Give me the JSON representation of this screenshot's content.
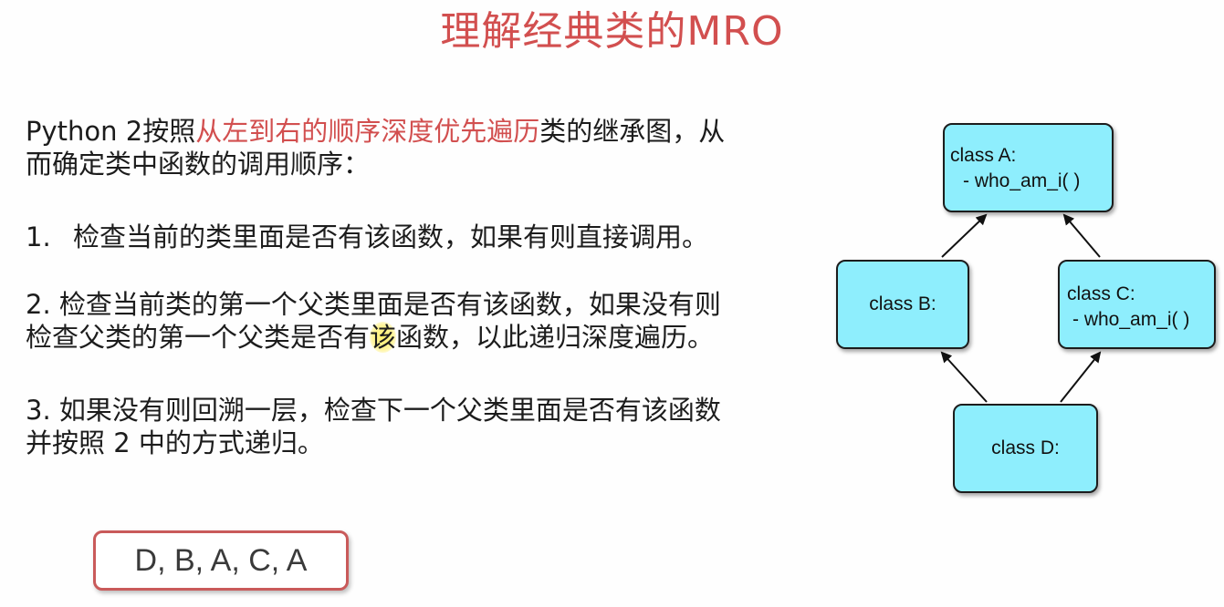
{
  "title": "理解经典类的MRO",
  "intro": {
    "before": "Python 2按照",
    "highlight": "从左到右的顺序深度优先遍历",
    "after": "类的继承图，从",
    "line2": "而确定类中函数的调用顺序："
  },
  "steps": [
    {
      "number": "1.",
      "text": "检查当前的类里面是否有该函数，如果有则直接调用。"
    },
    {
      "line1": "2. 检查当前类的第一个父类里面是否有该函数，如果没有则",
      "line2_before": "检查父类的第一个父类是否有",
      "line2_cursor": "该",
      "line2_after": "函数，以此递归深度遍历。"
    },
    {
      "line1": "3. 如果没有则回溯一层，检查下一个父类里面是否有该函数",
      "line2": "并按照 2 中的方式递归。"
    }
  ],
  "answer": "D, B, A, C, A",
  "diagram": {
    "nodes": {
      "A": {
        "name": "class A:",
        "method": "- who_am_i( )"
      },
      "B": {
        "name": "class B:"
      },
      "C": {
        "name": "class C:",
        "method": "- who_am_i( )"
      },
      "D": {
        "name": "class D:"
      }
    },
    "edges": [
      {
        "from": "B",
        "to": "A"
      },
      {
        "from": "C",
        "to": "A"
      },
      {
        "from": "D",
        "to": "B"
      },
      {
        "from": "D",
        "to": "C"
      }
    ],
    "node_fill": "#8eeefd"
  }
}
